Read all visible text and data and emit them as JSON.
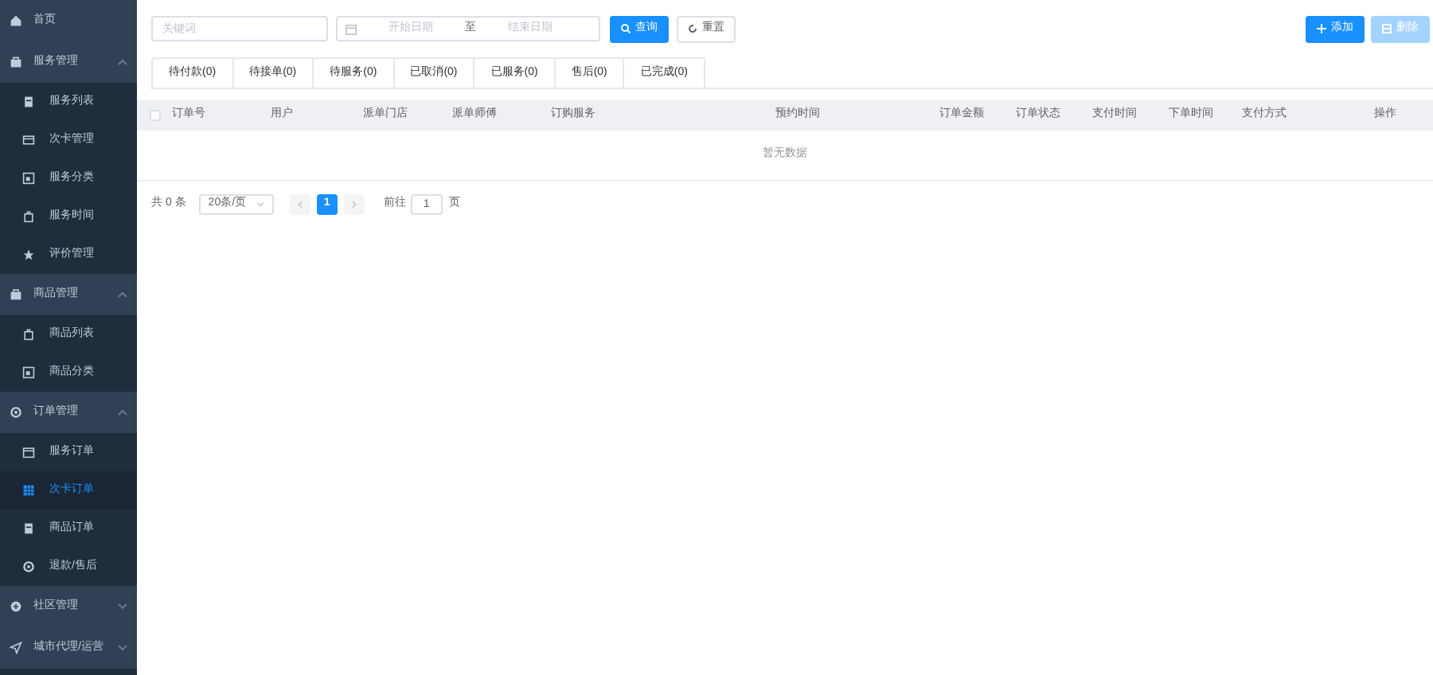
{
  "sidebar": {
    "items": [
      {
        "label": "首页"
      },
      {
        "label": "服务管理",
        "expanded": true,
        "children": [
          {
            "label": "服务列表",
            "selected": false
          },
          {
            "label": "次卡管理",
            "selected": false
          },
          {
            "label": "服务分类",
            "selected": false
          },
          {
            "label": "服务时间",
            "selected": false
          },
          {
            "label": "评价管理",
            "selected": false
          }
        ]
      },
      {
        "label": "商品管理",
        "expanded": true,
        "children": [
          {
            "label": "商品列表",
            "selected": false
          },
          {
            "label": "商品分类",
            "selected": false
          }
        ]
      },
      {
        "label": "订单管理",
        "expanded": true,
        "children": [
          {
            "label": "服务订单",
            "selected": false
          },
          {
            "label": "次卡订单",
            "selected": true
          },
          {
            "label": "商品订单",
            "selected": false
          },
          {
            "label": "退款/售后",
            "selected": false
          }
        ]
      },
      {
        "label": "社区管理",
        "expanded": false
      },
      {
        "label": "城市代理/运营",
        "expanded": false
      }
    ]
  },
  "filters": {
    "keyword": {
      "placeholder": "关键词"
    },
    "start_date": {
      "placeholder": "开始日期"
    },
    "separator": "至",
    "end_date": {
      "placeholder": "结束日期"
    },
    "search_button": "查询",
    "reset_button": "重置"
  },
  "actions": [
    {
      "label": "添加",
      "disabled": false
    },
    {
      "label": "删除",
      "disabled": true
    }
  ],
  "tabs": [
    {
      "label": "待付款(0)"
    },
    {
      "label": "待接单(0)"
    },
    {
      "label": "待服务(0)"
    },
    {
      "label": "已取消(0)"
    },
    {
      "label": "已服务(0)"
    },
    {
      "label": "售后(0)"
    },
    {
      "label": "已完成(0)"
    }
  ],
  "table": {
    "select_all_checked": false,
    "columns": [
      "订单号",
      "用户",
      "派单门店",
      "派单师傅",
      "订购服务",
      "预约时间",
      "订单金额",
      "订单状态",
      "支付时间",
      "下单时间",
      "支付方式",
      "操作"
    ],
    "empty_text": "暂无数据"
  },
  "pagination": {
    "total": "共 0 条",
    "page_size": "20条/页",
    "pages": [
      {
        "label": "1",
        "selected": true
      }
    ],
    "goto_label": "前往",
    "goto_value": "1",
    "goto_suffix": "页"
  }
}
